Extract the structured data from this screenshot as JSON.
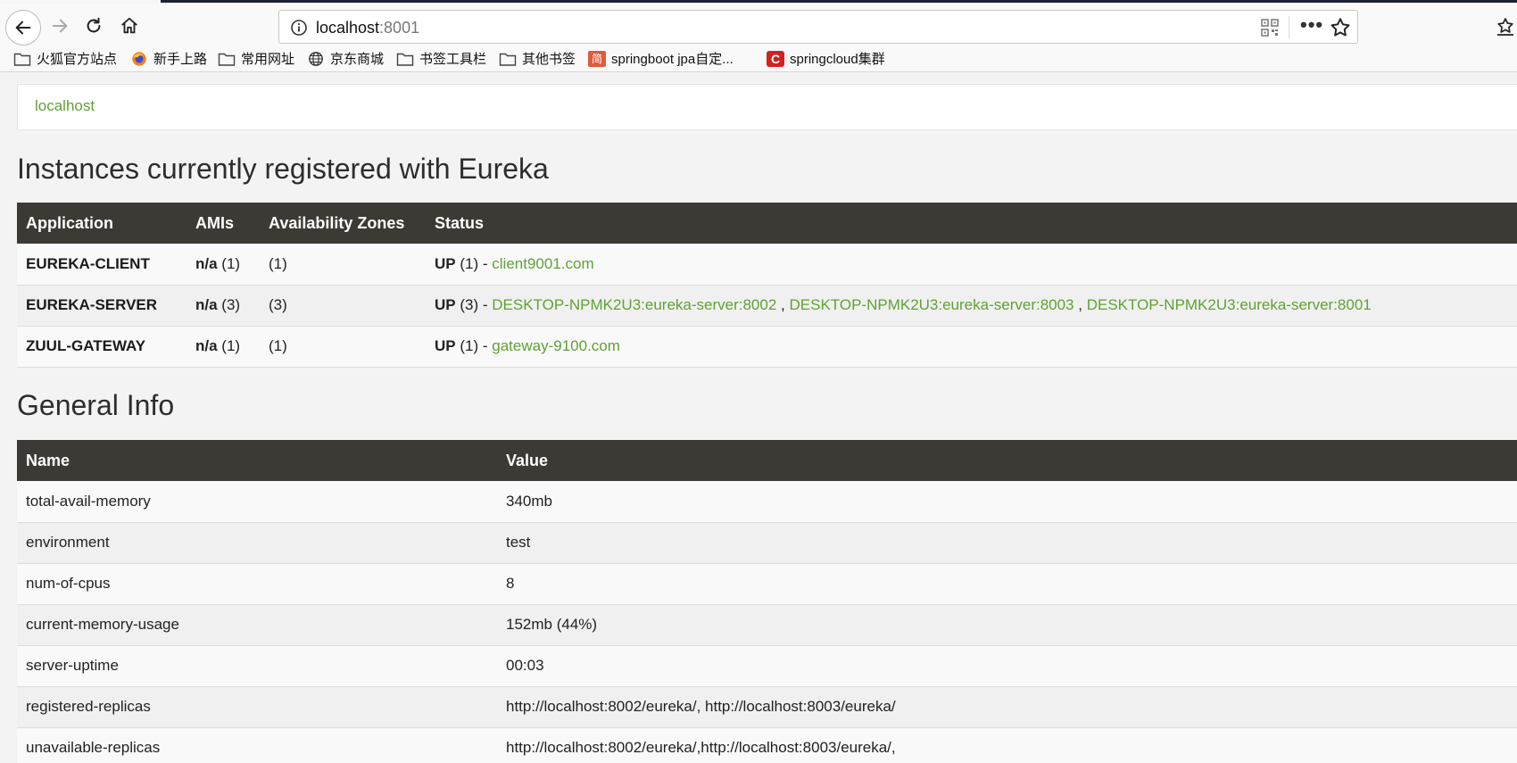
{
  "browser": {
    "url_host": "localhost",
    "url_port": ":8001",
    "menu_dots": "•••"
  },
  "bookmarks": [
    {
      "label": "火狐官方站点",
      "icon": "folder-icon"
    },
    {
      "label": "新手上路",
      "icon": "firefox-icon"
    },
    {
      "label": "常用网址",
      "icon": "folder-icon"
    },
    {
      "label": "京东商城",
      "icon": "globe-icon"
    },
    {
      "label": "书签工具栏",
      "icon": "folder-icon"
    },
    {
      "label": "其他书签",
      "icon": "folder-icon"
    },
    {
      "label": "springboot jpa自定...",
      "icon": "jianshu-icon",
      "icon_text": "简"
    },
    {
      "label": "springcloud集群",
      "icon": "csdn-icon",
      "icon_text": "C"
    }
  ],
  "header": {
    "crumb": "localhost"
  },
  "instances": {
    "title": "Instances currently registered with Eureka",
    "columns": [
      "Application",
      "AMIs",
      "Availability Zones",
      "Status"
    ],
    "rows": [
      {
        "app": "EUREKA-CLIENT",
        "ami": "n/a",
        "ami_count": "(1)",
        "zones": "(1)",
        "status": "UP",
        "status_count": "(1) -",
        "links": [
          "client9001.com"
        ]
      },
      {
        "app": "EUREKA-SERVER",
        "ami": "n/a",
        "ami_count": "(3)",
        "zones": "(3)",
        "status": "UP",
        "status_count": "(3) -",
        "links": [
          "DESKTOP-NPMK2U3:eureka-server:8002",
          "DESKTOP-NPMK2U3:eureka-server:8003",
          "DESKTOP-NPMK2U3:eureka-server:8001"
        ]
      },
      {
        "app": "ZUUL-GATEWAY",
        "ami": "n/a",
        "ami_count": "(1)",
        "zones": "(1)",
        "status": "UP",
        "status_count": "(1) -",
        "links": [
          "gateway-9100.com"
        ]
      }
    ]
  },
  "general": {
    "title": "General Info",
    "columns": [
      "Name",
      "Value"
    ],
    "rows": [
      {
        "name": "total-avail-memory",
        "value": "340mb"
      },
      {
        "name": "environment",
        "value": "test"
      },
      {
        "name": "num-of-cpus",
        "value": "8"
      },
      {
        "name": "current-memory-usage",
        "value": "152mb (44%)"
      },
      {
        "name": "server-uptime",
        "value": "00:03"
      },
      {
        "name": "registered-replicas",
        "value": "http://localhost:8002/eureka/, http://localhost:8003/eureka/"
      },
      {
        "name": "unavailable-replicas",
        "value": "http://localhost:8002/eureka/,http://localhost:8003/eureka/,"
      }
    ]
  },
  "colors": {
    "header_bg": "#3d3935",
    "link": "#5fa134",
    "tab_strip": "#1d2235"
  }
}
